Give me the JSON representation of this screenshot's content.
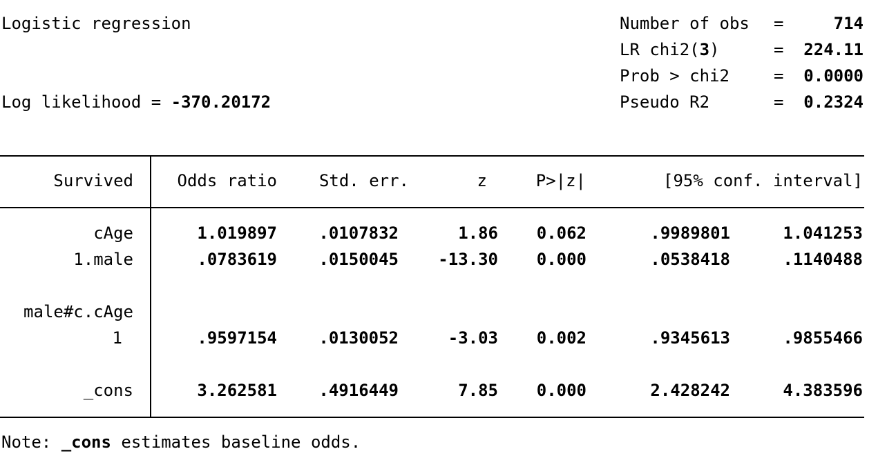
{
  "header": {
    "model_title": "Logistic regression",
    "loglik_label": "Log likelihood = ",
    "loglik_value": "-370.20172",
    "stats": [
      {
        "label": "Number of obs",
        "eq": "=",
        "value": "714"
      },
      {
        "label": "LR chi2(",
        "label_num": "3",
        "label_close": ")",
        "eq": "=",
        "value": "224.11"
      },
      {
        "label": "Prob > chi2",
        "eq": "=",
        "value": "0.0000"
      },
      {
        "label": "Pseudo R2",
        "eq": "=",
        "value": "0.2324"
      }
    ]
  },
  "table": {
    "columns": {
      "depvar": "Survived",
      "odds": "Odds ratio",
      "se": "Std. err.",
      "z": "z",
      "p": "P>|z|",
      "ci": "[95% conf. interval]"
    },
    "rows": [
      {
        "label": "cAge",
        "odds": "1.019897",
        "se": ".0107832",
        "z": "1.86",
        "p": "0.062",
        "lo": ".9989801",
        "hi": "1.041253"
      },
      {
        "label": "1.male",
        "odds": ".0783619",
        "se": ".0150045",
        "z": "-13.30",
        "p": "0.000",
        "lo": ".0538418",
        "hi": ".1140488"
      },
      {
        "label": "male#c.cAge"
      },
      {
        "label": "1",
        "odds": ".9597154",
        "se": ".0130052",
        "z": "-3.03",
        "p": "0.002",
        "lo": ".9345613",
        "hi": ".9855466"
      },
      {
        "label": "_cons",
        "odds": "3.262581",
        "se": ".4916449",
        "z": "7.85",
        "p": "0.000",
        "lo": "2.428242",
        "hi": "4.383596"
      }
    ]
  },
  "footer": {
    "note_prefix": "Note: ",
    "note_term": "_cons",
    "note_suffix": " estimates baseline odds."
  }
}
